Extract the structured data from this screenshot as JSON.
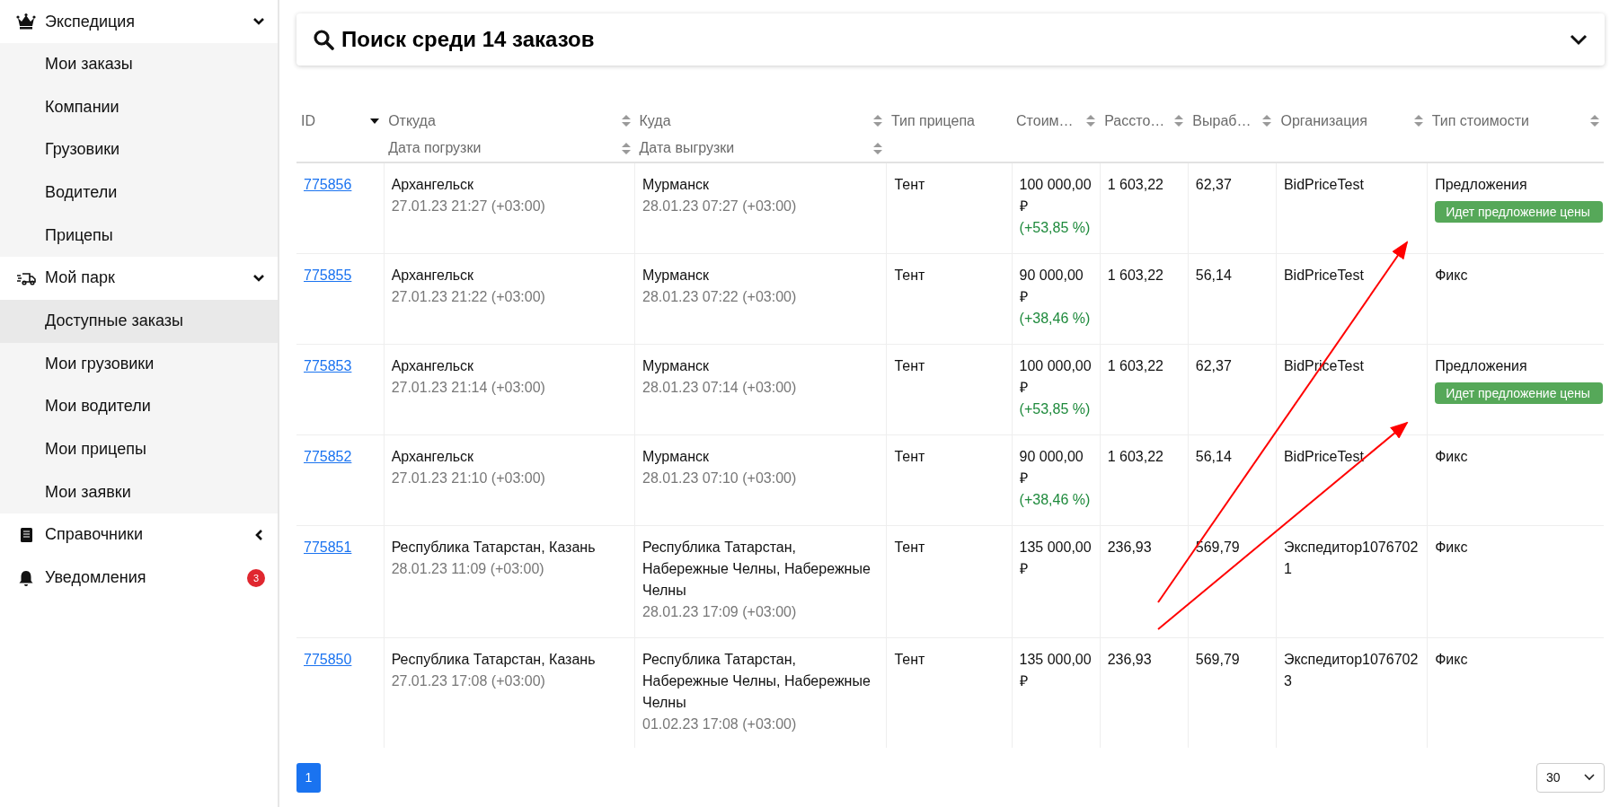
{
  "sidebar": {
    "groups": [
      {
        "label": "Экспедиция",
        "expanded": true,
        "children": [
          {
            "label": "Мои заказы",
            "selected": false
          },
          {
            "label": "Компании",
            "selected": false
          },
          {
            "label": "Грузовики",
            "selected": false
          },
          {
            "label": "Водители",
            "selected": false
          },
          {
            "label": "Прицепы",
            "selected": false
          }
        ]
      },
      {
        "label": "Мой парк",
        "expanded": true,
        "children": [
          {
            "label": "Доступные заказы",
            "selected": true
          },
          {
            "label": "Мои грузовики",
            "selected": false
          },
          {
            "label": "Мои водители",
            "selected": false
          },
          {
            "label": "Мои прицепы",
            "selected": false
          },
          {
            "label": "Мои заявки",
            "selected": false
          }
        ]
      },
      {
        "label": "Справочники",
        "expanded": false
      },
      {
        "label": "Уведомления",
        "badge": "3"
      }
    ]
  },
  "search": {
    "title": "Поиск среди 14 заказов",
    "expanded": false
  },
  "table": {
    "columns": [
      {
        "label": "ID",
        "sortable": true,
        "sorted": true
      },
      {
        "label": "Откуда",
        "sublabel": "Дата погрузки",
        "sortable": true,
        "sorted": false
      },
      {
        "label": "Куда",
        "sublabel": "Дата выгрузки",
        "sortable": true,
        "sorted": false
      },
      {
        "label": "Тип прицепа",
        "sortable": false
      },
      {
        "label": "Стоим…",
        "sortable": true,
        "sorted": false
      },
      {
        "label": "Рассто…",
        "sortable": true,
        "sorted": false
      },
      {
        "label": "Выраб…",
        "sortable": true,
        "sorted": false
      },
      {
        "label": "Организация",
        "sortable": true,
        "sorted": false
      },
      {
        "label": "Тип стоимости",
        "sortable": true,
        "sorted": false
      }
    ],
    "rows": [
      {
        "id": "775856",
        "from": "Архангельск",
        "from_date": "27.01.23 21:27 (+03:00)",
        "to": "Мурманск",
        "to_date": "28.01.23 07:27 (+03:00)",
        "trailer": "Тент",
        "cost": "100 000,00 ₽",
        "delta": "(+53,85 %)",
        "distance": "1 603,22",
        "rate": "62,37",
        "org": "BidPriceTest",
        "price_type": "Предложения",
        "status": "Идет предложение цены"
      },
      {
        "id": "775855",
        "from": "Архангельск",
        "from_date": "27.01.23 21:22 (+03:00)",
        "to": "Мурманск",
        "to_date": "28.01.23 07:22 (+03:00)",
        "trailer": "Тент",
        "cost": "90 000,00 ₽",
        "delta": "(+38,46 %)",
        "distance": "1 603,22",
        "rate": "56,14",
        "org": "BidPriceTest",
        "price_type": "Фикс"
      },
      {
        "id": "775853",
        "from": "Архангельск",
        "from_date": "27.01.23 21:14 (+03:00)",
        "to": "Мурманск",
        "to_date": "28.01.23 07:14 (+03:00)",
        "trailer": "Тент",
        "cost": "100 000,00 ₽",
        "delta": "(+53,85 %)",
        "distance": "1 603,22",
        "rate": "62,37",
        "org": "BidPriceTest",
        "price_type": "Предложения",
        "status": "Идет предложение цены"
      },
      {
        "id": "775852",
        "from": "Архангельск",
        "from_date": "27.01.23 21:10 (+03:00)",
        "to": "Мурманск",
        "to_date": "28.01.23 07:10 (+03:00)",
        "trailer": "Тент",
        "cost": "90 000,00 ₽",
        "delta": "(+38,46 %)",
        "distance": "1 603,22",
        "rate": "56,14",
        "org": "BidPriceTest",
        "price_type": "Фикс"
      },
      {
        "id": "775851",
        "from": "Республика Татарстан, Казань",
        "from_date": "28.01.23 11:09 (+03:00)",
        "to": "Республика Татарстан, Набережные Челны, Набережные Челны",
        "to_date": "28.01.23 17:09 (+03:00)",
        "trailer": "Тент",
        "cost": "135 000,00 ₽",
        "distance": "236,93",
        "rate": "569,79",
        "org": "Экспедитор10767021",
        "price_type": "Фикс"
      },
      {
        "id": "775850",
        "from": "Республика Татарстан, Казань",
        "from_date": "27.01.23 17:08 (+03:00)",
        "to": "Республика Татарстан, Набережные Челны, Набережные Челны",
        "to_date": "01.02.23 17:08 (+03:00)",
        "trailer": "Тент",
        "cost": "135 000,00 ₽",
        "distance": "236,93",
        "rate": "569,79",
        "org": "Экспедитор10767023",
        "price_type": "Фикс"
      }
    ]
  },
  "pagination": {
    "pages": [
      {
        "label": "1",
        "selected": true
      }
    ],
    "page_size": "30"
  }
}
